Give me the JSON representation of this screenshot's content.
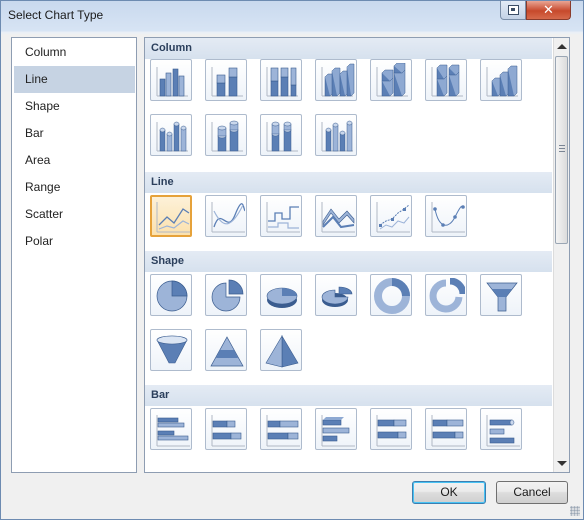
{
  "window": {
    "title": "Select Chart Type",
    "close_glyph": "✕"
  },
  "categories": [
    {
      "label": "Column",
      "selected": false
    },
    {
      "label": "Line",
      "selected": true
    },
    {
      "label": "Shape",
      "selected": false
    },
    {
      "label": "Bar",
      "selected": false
    },
    {
      "label": "Area",
      "selected": false
    },
    {
      "label": "Range",
      "selected": false
    },
    {
      "label": "Scatter",
      "selected": false
    },
    {
      "label": "Polar",
      "selected": false
    }
  ],
  "groups": [
    {
      "label": "Column",
      "icons": [
        "column-clustered-icon",
        "column-stacked-icon",
        "column-stacked-100-icon",
        "column-3d-clustered-icon",
        "column-3d-stacked-icon",
        "column-3d-stacked-100-icon",
        "column-3d-icon",
        "cylinder-clustered-icon",
        "cylinder-stacked-icon",
        "cylinder-stacked-100-icon",
        "cylinder-3d-icon"
      ]
    },
    {
      "label": "Line",
      "icons": [
        "line-icon",
        "smooth-line-icon",
        "stepped-line-icon",
        "3d-line-icon",
        "line-markers-icon",
        "smooth-line-markers-icon"
      ],
      "selected_index": 0
    },
    {
      "label": "Shape",
      "icons": [
        "pie-icon",
        "exploded-pie-icon",
        "pie-3d-icon",
        "exploded-pie-3d-icon",
        "doughnut-icon",
        "exploded-doughnut-icon",
        "funnel-icon",
        "funnel-3d-icon",
        "pyramid-icon",
        "pyramid-3d-icon"
      ]
    },
    {
      "label": "Bar",
      "icons": [
        "bar-clustered-icon",
        "bar-stacked-icon",
        "bar-stacked-100-icon",
        "bar-3d-clustered-icon",
        "bar-3d-stacked-icon",
        "bar-3d-stacked-100-icon",
        "cylinder-bar-icon"
      ]
    }
  ],
  "buttons": {
    "ok": "OK",
    "cancel": "Cancel"
  },
  "colors": {
    "accent_blue": "#5b7fb5",
    "selection_border": "#e6a23a",
    "close_red": "#c7492c"
  }
}
